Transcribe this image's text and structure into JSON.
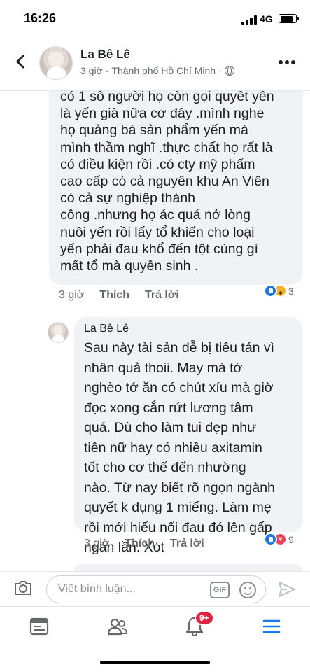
{
  "status_bar": {
    "time": "16:26",
    "network": "4G",
    "battery_level": 0.85
  },
  "header": {
    "name": "La Bê Lê",
    "time": "3 giờ",
    "separator": "·",
    "location": "Thành phố Hồ Chí Minh",
    "separator2": "·",
    "privacy_icon": "globe-icon",
    "back_icon": "chevron-left-icon",
    "more_icon": "more-icon"
  },
  "comment1": {
    "text": "có 1 sô người họ còn gọi quyêt yên\nlà yến già nữa cơ đây .mình nghe\nhọ quảng bá sản phẩm yến mà\nmình thầm nghĩ .thực chất họ rất là\ncó điều kiện rồi .có cty mỹ phẩm\ncao cấp có cả nguyên khu An Viên\ncó cả sự nghiệp thành\ncông .nhưng họ ác quá nở lòng\nnuôi yến rồi lấy tổ khiến cho loại\nyến phải đau khổ đến tột cùng gì\nmất tổ mà quyên sinh .",
    "time": "3 giờ",
    "like_label": "Thích",
    "reply_label": "Trả lời",
    "reaction_count": "3",
    "reactions": [
      "like",
      "wow"
    ]
  },
  "reply1": {
    "author": "La Bê Lê",
    "text": "Sau này tài sản dễ bị tiêu tán vì\nnhân quả thoii. May mà tớ\nnghèo tớ ăn có chút xíu mà giờ\nđọc xong cắn rứt lương tâm\nquá. Dù cho làm tui đẹp như\ntiên nữ hay có nhiều axitamin\ntốt cho cơ thể đến nhường\nnào. Từ nay biết rõ ngọn ngành\nquyết k đụng 1 miếng. Làm mẹ\nrồi mới hiểu nổi đau đó lên gấp\nngàn lần. Xót",
    "time": "3 giờ",
    "like_label": "Thích",
    "reply_label": "Trả lời",
    "reaction_count": "9",
    "reactions": [
      "like",
      "love"
    ]
  },
  "composer": {
    "placeholder": "Viết bình luận...",
    "gif_label": "GIF"
  },
  "bottom_nav": {
    "notification_badge": "9+",
    "items": [
      "news-feed-icon",
      "friends-icon",
      "notifications-icon",
      "menu-icon"
    ]
  },
  "colors": {
    "bubble": "#f0f2f5",
    "meta_text": "#65676b",
    "like_blue": "#1877f2",
    "love_red": "#f33e58",
    "wow_yellow": "#f7b125",
    "badge_red": "#e41e3f"
  }
}
